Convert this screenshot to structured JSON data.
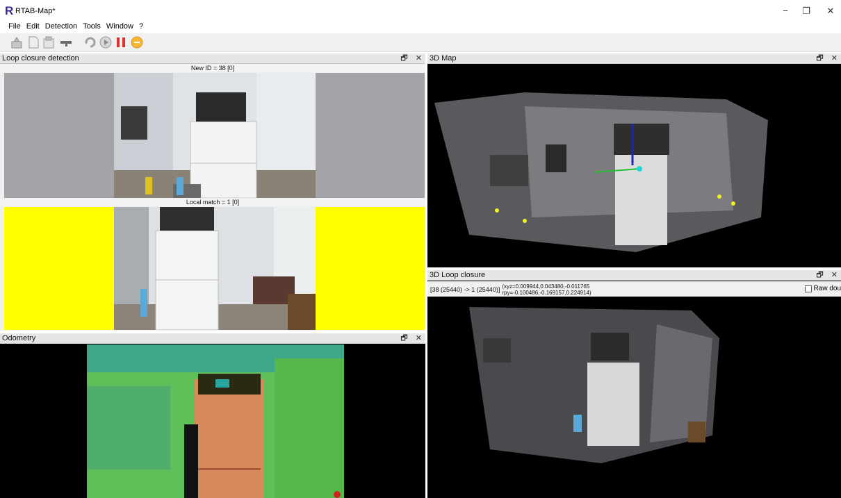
{
  "window": {
    "logo": "R",
    "title": "RTAB-Map*",
    "minimize": "−",
    "restore": "❐",
    "close": "✕"
  },
  "menu": [
    "File",
    "Edit",
    "Detection",
    "Tools",
    "Window",
    "?"
  ],
  "toolbar": {
    "icons": [
      "new-database-icon",
      "open-database-icon",
      "save-database-icon",
      "sensor-icon",
      "reset-odometry-icon",
      "start-icon",
      "pause-icon",
      "stop-icon"
    ]
  },
  "panels": {
    "loop_closure_detection": {
      "title": "Loop closure detection",
      "new_id_label": "New ID = 38 [0]",
      "local_match_label": "Local match = 1 [0]"
    },
    "odometry": {
      "title": "Odometry"
    },
    "map3d": {
      "title": "3D Map"
    },
    "loop3d": {
      "title": "3D Loop closure",
      "link_text": "[38 (25440) -> 1 (25440)]",
      "xyz_text": "(xyz=0.009944,0.043480,-0.011765",
      "rpy_text": "rpy=-0.100486,-0.169157,0.224914)",
      "raw_label": "Raw dou"
    },
    "dock_float": "🗗",
    "dock_close": "✕"
  },
  "colors": {
    "loop_match_bg": "#ffff00",
    "new_id_bg": "#a4a4a8",
    "feature_points": "#f2f21e"
  }
}
